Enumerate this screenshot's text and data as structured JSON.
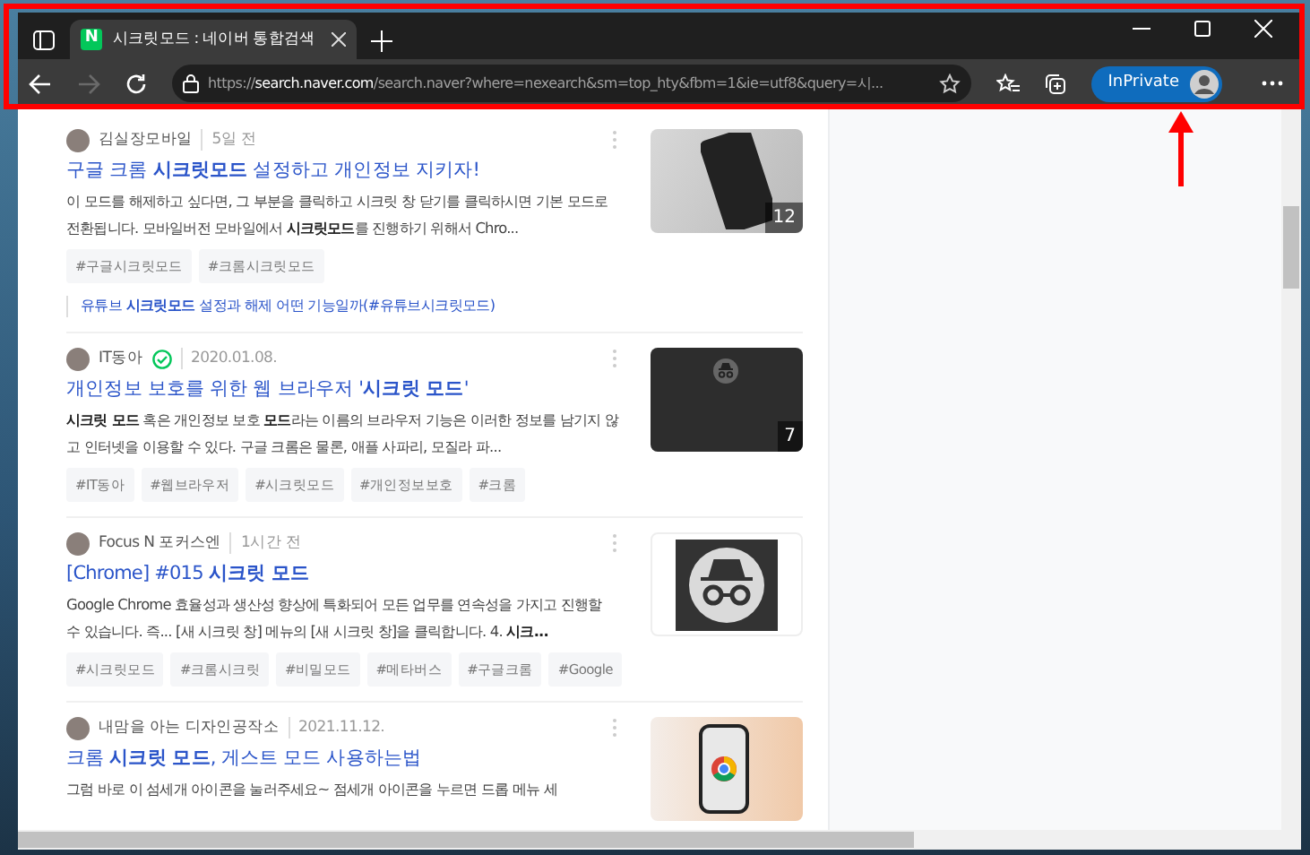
{
  "browser": {
    "tab": {
      "title": "시크릿모드 : 네이버 통합검색",
      "favicon": "N",
      "selected": true
    },
    "address": "https://**search.naver.com**/search.naver?where=nexearch&sm=top_hty&fbm=1&ie=utf8&query=시...",
    "forward_disabled": true,
    "profile_label": "InPrivate"
  },
  "results": [
    {
      "author": "김실장모바일",
      "verified": false,
      "time": "5일 전",
      "title": "구글 크롬 **시크릿모드** 설정하고 개인정보 지키자!",
      "snippet": "이 모드를 해제하고 싶다면, 그 부분을 클릭하고 시크릿 창 닫기를 클릭하시면 기본 모드로 전환됩니다. 모바일버전 모바일에서 **시크릿모드**를 진행하기 위해서 Chro...",
      "tags": [
        "#구글시크릿모드",
        "#크롬시크릿모드"
      ],
      "related": "유튜브 **시크릿모드** 설정과 해제 어떤 기능일까(#유튜브시크릿모드)",
      "thumbnail": {
        "kind": "phone-photo",
        "count": "12"
      }
    },
    {
      "author": "IT동아",
      "verified": true,
      "time": "2020.01.08.",
      "title": "개인정보 보호를 위한 웹 브라우저 '**시크릿 모드**'",
      "snippet": "**시크릿 모드** 혹은 개인정보 보호 **모드**라는 이름의 브라우저 기능은 이러한 정보를 남기지 않고 인터넷을 이용할 수 있다. 구글 크롬은 물론, 애플 사파리, 모질라 파...",
      "tags": [
        "#IT동아",
        "#웹브라우저",
        "#시크릿모드",
        "#개인정보보호",
        "#크롬"
      ],
      "thumbnail": {
        "kind": "dark-screen",
        "count": "7"
      }
    },
    {
      "author": "Focus N 포커스엔",
      "verified": false,
      "time": "1시간 전",
      "title": "[Chrome] #015 **시크릿 모드**",
      "snippet": "Google Chrome 효율성과 생산성 향상에 특화되어 모든 업무를 연속성을 가지고 진행할 수 있습니다. 즉... [새 시크릿 창] 메뉴의 [새 시크릿 창]을 클릭합니다. 4. **시크...**",
      "tags": [
        "#시크릿모드",
        "#크롬시크릿",
        "#비밀모드",
        "#메타버스",
        "#구글크롬",
        "#Google"
      ],
      "thumbnail": {
        "kind": "incognito"
      }
    },
    {
      "author": "내맘을 아는 디자인공작소",
      "verified": false,
      "time": "2021.11.12.",
      "title": "크롬 **시크릿 모드**, 게스트 모드 사용하는법",
      "snippet": "그럼 바로 이 섬세개 아이콘을 눌러주세요~ 점세개 아이콘을 누르면 드롭 메뉴 세",
      "thumbnail": {
        "kind": "hand-photo"
      }
    }
  ]
}
